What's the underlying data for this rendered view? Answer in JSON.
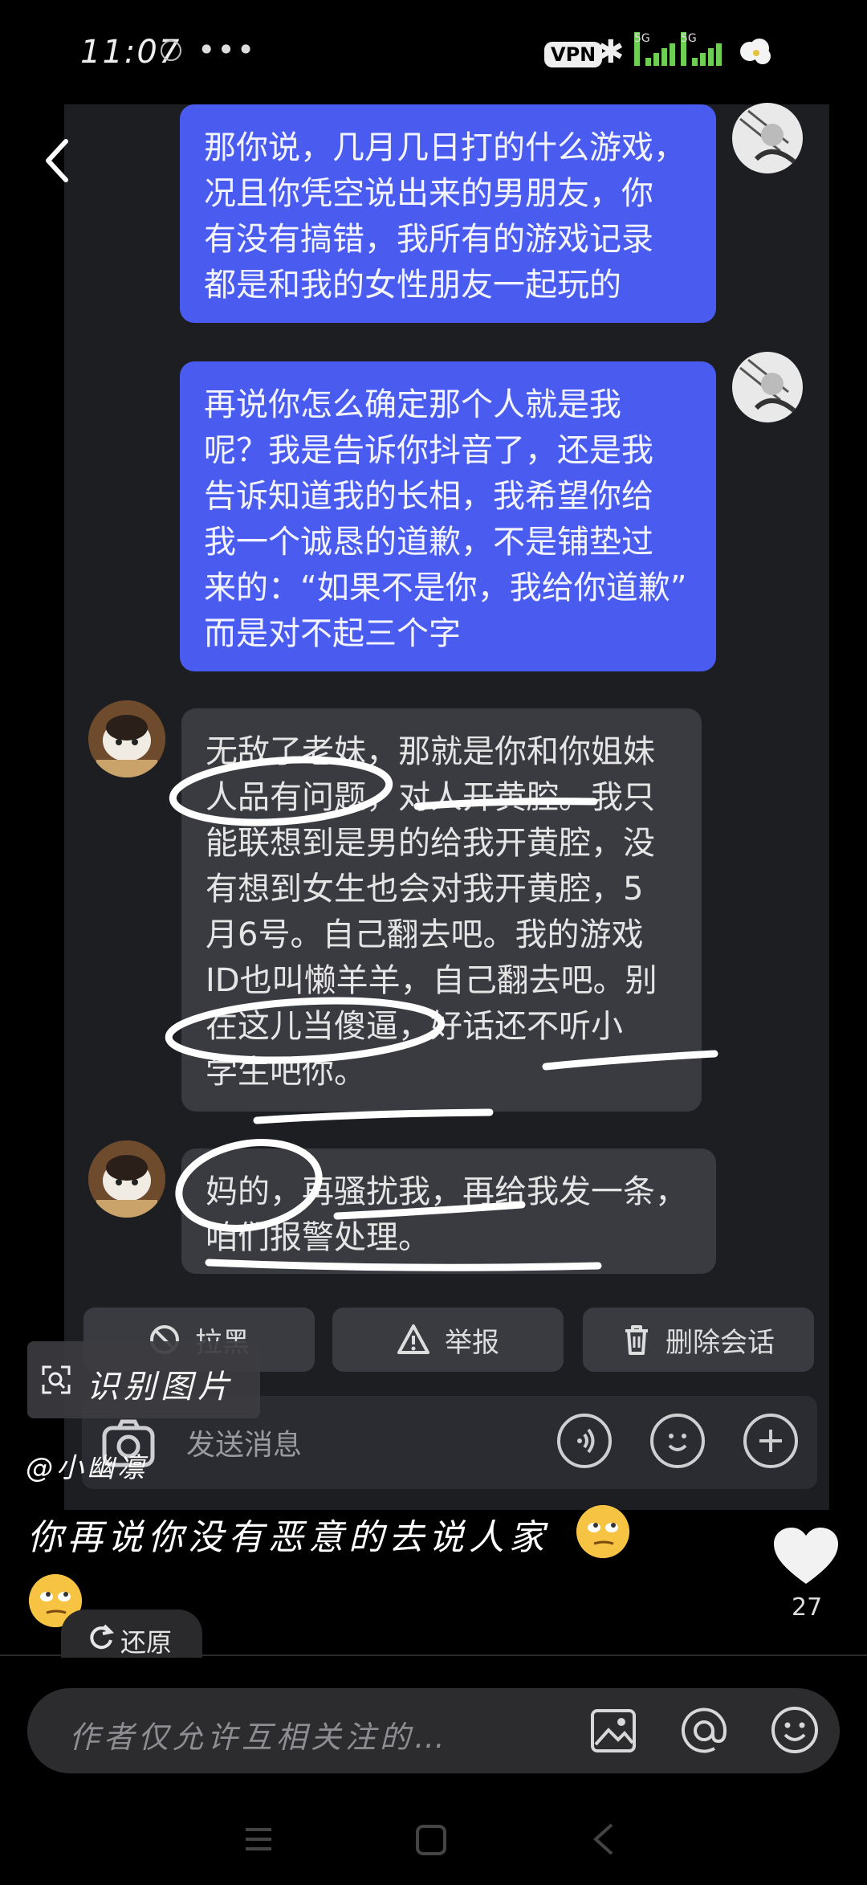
{
  "status_bar": {
    "time": "11:07",
    "more": "•••",
    "vpn": "VPN",
    "sim1": "5G",
    "sim2": "5G"
  },
  "chat": {
    "messages": [
      {
        "side": "out",
        "text": "那你说，几月几日打的什么游戏，\n况且你凭空说出来的男朋友，你\n有没有搞错，我所有的游戏记录\n都是和我的女性朋友一起玩的"
      },
      {
        "side": "out",
        "text": "再说你怎么确定那个人就是我\n呢？我是告诉你抖音了，还是我\n告诉知道我的长相，我希望你给\n我一个诚恳的道歉，不是铺垫过\n来的：“如果不是你，我给你道歉”\n而是对不起三个字"
      },
      {
        "side": "in",
        "text": "无敌了老妹，那就是你和你姐妹\n人品有问题，对人开黄腔。我只\n能联想到是男的给我开黄腔，没\n有想到女生也会对我开黄腔，5\n月6号。自己翻去吧。我的游戏\nID也叫懒羊羊，自己翻去吧。别\n在这儿当傻逼，好话还不听小\n学生吧你。"
      },
      {
        "side": "in",
        "text": "妈的，再骚扰我，再给我发一条，\n咱们报警处理。"
      }
    ],
    "actions": {
      "block": "拉黑",
      "report": "举报",
      "delete": "删除会话"
    },
    "input_placeholder": "发送消息"
  },
  "overlay": {
    "recognize_image": "识别图片",
    "author": "@小幽凛",
    "caption_line1": "你再说你没有恶意的去说人家",
    "restore": "还原",
    "like_count": "27",
    "comment_placeholder": "作者仅允许互相关注的…"
  },
  "colors": {
    "outgoing_bubble": "#4a5cf0",
    "incoming_bubble": "#3a3b41",
    "chat_background": "#1d1e22"
  }
}
